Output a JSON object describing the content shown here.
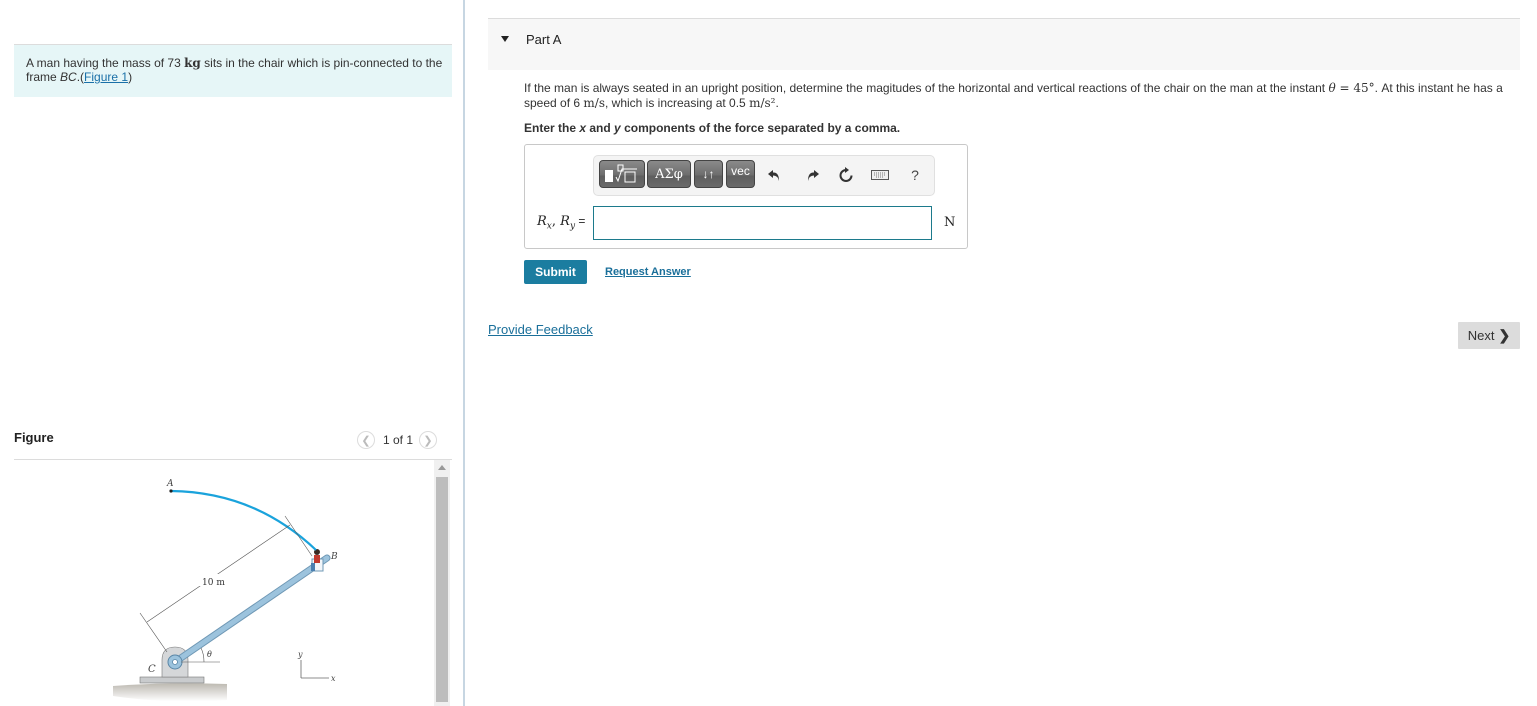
{
  "problem": {
    "intro_pre": "A man having the mass of 73 ",
    "intro_unit": "kg",
    "intro_mid": " sits in the chair which is pin-connected to the frame ",
    "intro_frame": "BC",
    "intro_dot": ".(",
    "figure_link": "Figure 1",
    "intro_close": ")"
  },
  "figure": {
    "title": "Figure",
    "pager": "1 of 1",
    "prev_icon": "chevron-left-icon",
    "next_icon": "chevron-right-icon",
    "labels": {
      "A": "A",
      "B": "B",
      "C": "C",
      "length": "10 m",
      "theta": "θ",
      "y_axis": "y",
      "x_axis": "x"
    },
    "colors": {
      "path": "#1aa3dc",
      "arm": "#9cc3dd"
    }
  },
  "part": {
    "title": "Part A",
    "question_1": "If the man is always seated in an upright position, determine the magitudes of the horizontal and vertical reactions of the chair on the man at the instant ",
    "theta": "θ",
    "equals": " = ",
    "angle": "45°",
    "question_2": ". At this instant he has a speed of 6 ",
    "speed_unit": "m/s",
    "question_3": ", which is increasing at 0.5 ",
    "accel_unit": "m/s²",
    "question_4": ".",
    "instruction_pre": "Enter the ",
    "instruction_x": "x",
    "instruction_and": " and ",
    "instruction_y": "y",
    "instruction_post": " components of the force separated by a comma."
  },
  "toolbar": {
    "templates_icon": "■∜□",
    "greek_label": "ΑΣφ",
    "arrows_label": "↓↑",
    "vec_label": "vec",
    "undo_icon": "undo-icon",
    "redo_icon": "redo-icon",
    "reset_icon": "reset-icon",
    "keyboard_icon": "keyboard-icon",
    "help_label": "?"
  },
  "answer": {
    "label_R": "R",
    "label_x": "x",
    "label_sep": ", ",
    "label_y": "y",
    "label_eq": " =",
    "value": "",
    "placeholder": "",
    "unit": "N"
  },
  "actions": {
    "submit": "Submit",
    "request_answer": "Request Answer",
    "provide_feedback": "Provide Feedback",
    "next": "Next",
    "next_chevron": "❯"
  }
}
